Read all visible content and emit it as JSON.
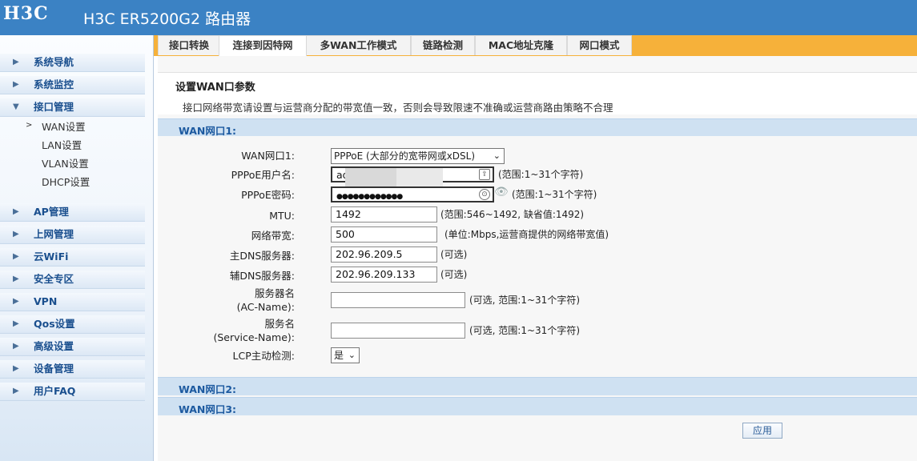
{
  "header": {
    "logo": "H3C",
    "title": "H3C ER5200G2 路由器"
  },
  "tabs": [
    "接口转换",
    "连接到因特网",
    "多WAN工作模式",
    "链路检测",
    "MAC地址克隆",
    "网口模式"
  ],
  "sidebar": {
    "items": [
      "系统导航",
      "系统监控",
      "接口管理",
      "AP管理",
      "上网管理",
      "云WiFi",
      "安全专区",
      "VPN",
      "Qos设置",
      "高级设置",
      "设备管理",
      "用户FAQ"
    ],
    "sub_items": [
      "WAN设置",
      "LAN设置",
      "VLAN设置",
      "DHCP设置"
    ]
  },
  "section": {
    "title": "设置WAN口参数",
    "note": "接口网络带宽请设置与运营商分配的带宽值一致，否则会导致限速不准确或运营商路由策略不合理"
  },
  "wan1": {
    "header": "WAN网口1:",
    "labels": {
      "wan_port": "WAN网口1:",
      "pppoe_user": "PPPoE用户名:",
      "pppoe_pass": "PPPoE密码:",
      "mtu": "MTU:",
      "bandwidth": "网络带宽:",
      "dns1": "主DNS服务器:",
      "dns2": "辅DNS服务器:",
      "ac_name_1": "服务器名",
      "ac_name_2": "(AC-Name):",
      "service_1": "服务名",
      "service_2": "(Service-Name):",
      "lcp": "LCP主动检测:"
    },
    "values": {
      "wan_mode": "PPPoE (大部分的宽带网或xDSL)",
      "pppoe_user": "ad",
      "pppoe_pass": "●●●●●●●●●●●●",
      "mtu": "1492",
      "bandwidth": "500",
      "dns1": "202.96.209.5",
      "dns2": "202.96.209.133",
      "ac_name": "",
      "service_name": "",
      "lcp": "是"
    },
    "hints": {
      "pppoe_user": "(范围:1~31个字符)",
      "pppoe_pass": "(范围:1~31个字符)",
      "mtu": "(范围:546~1492, 缺省值:1492)",
      "bandwidth": "(单位:Mbps,运营商提供的网络带宽值)",
      "dns1": "(可选)",
      "dns2": "(可选)",
      "ac_name": "(可选, 范围:1~31个字符)",
      "service_name": "(可选, 范围:1~31个字符)"
    }
  },
  "wan2": {
    "header": "WAN网口2:"
  },
  "wan3": {
    "header": "WAN网口3:"
  },
  "apply_label": "应用"
}
